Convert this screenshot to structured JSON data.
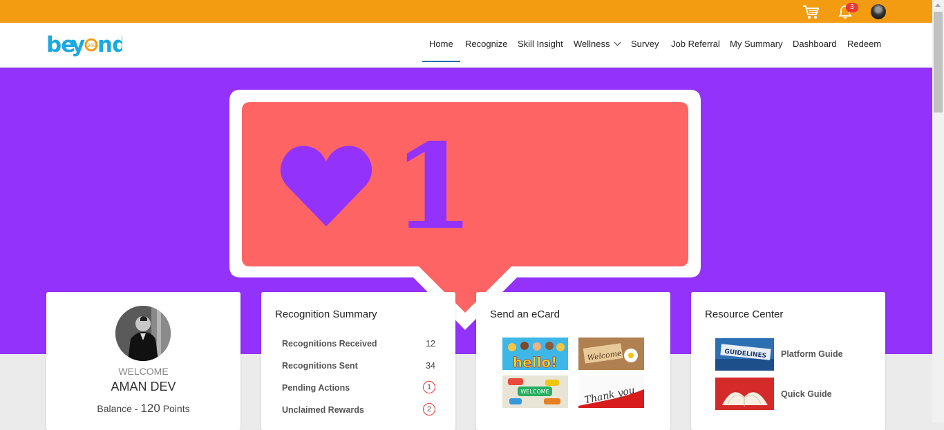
{
  "header": {
    "notification_count": "3",
    "icons": [
      "cart-icon",
      "bell-icon",
      "user-avatar"
    ],
    "accent_color": "#f39c12"
  },
  "navbar": {
    "logo_text": "beyond",
    "logo_sub": "360",
    "items": [
      {
        "label": "Home",
        "active": true
      },
      {
        "label": "Recognize"
      },
      {
        "label": "Skill Insight"
      },
      {
        "label": "Wellness",
        "has_dropdown": true
      },
      {
        "label": "Survey"
      },
      {
        "label": "Job Referral"
      },
      {
        "label": "My Summary"
      },
      {
        "label": "Dashboard"
      },
      {
        "label": "Redeem"
      }
    ]
  },
  "hero": {
    "bg_color": "#9332fb",
    "like_count": "1"
  },
  "profile": {
    "welcome": "WELCOME",
    "name": "AMAN DEV",
    "balance_label": "Balance -",
    "balance_points": "120",
    "points_label": "Points"
  },
  "recognition_summary": {
    "title": "Recognition Summary",
    "rows": [
      {
        "label": "Recognitions Received",
        "value": "12"
      },
      {
        "label": "Recognitions Sent",
        "value": "34"
      },
      {
        "label": "Pending Actions",
        "value": "1"
      },
      {
        "label": "Unclaimed Rewards",
        "value": "2"
      }
    ]
  },
  "ecard": {
    "title": "Send an eCard",
    "cards": [
      "hello!",
      "Welcome",
      "WELCOME",
      "Thank you"
    ]
  },
  "resource_center": {
    "title": "Resource Center",
    "items": [
      {
        "label": "Platform Guide",
        "thumb": "GUIDELINES"
      },
      {
        "label": "Quick Guide"
      }
    ]
  }
}
